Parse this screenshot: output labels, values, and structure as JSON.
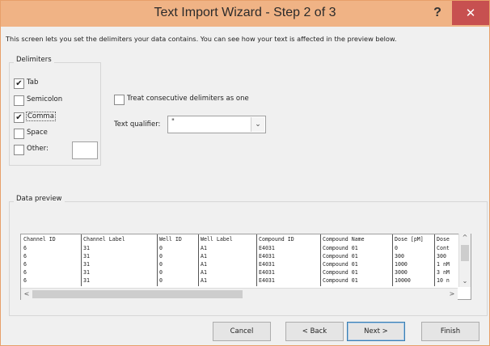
{
  "window": {
    "title": "Text Import Wizard - Step 2 of 3",
    "help_label": "?",
    "close_label": "✕"
  },
  "intro_text": "This screen lets you set the delimiters your data contains.  You can see how your text is affected in the preview below.",
  "delimiters": {
    "group_label": "Delimiters",
    "tab": {
      "label": "Tab",
      "checked": true
    },
    "semicolon": {
      "label": "Semicolon",
      "checked": false
    },
    "comma": {
      "label": "Comma",
      "checked": true
    },
    "space": {
      "label": "Space",
      "checked": false
    },
    "other": {
      "label": "Other:",
      "checked": false,
      "value": ""
    },
    "check_mark": "✔"
  },
  "consecutive": {
    "label": "Treat consecutive delimiters as one",
    "checked": false
  },
  "qualifier": {
    "label": "Text qualifier:",
    "value": "\"",
    "dropdown_icon": "chevron-down-icon",
    "arrow": "⌄"
  },
  "preview": {
    "label": "Data preview",
    "headers": [
      "Channel ID",
      "Channel Label",
      "Well ID",
      "Well Label",
      "Compound ID",
      "Compound Name",
      "Dose [pM]",
      "Dose"
    ],
    "rows": [
      [
        "6",
        "31",
        "0",
        "A1",
        "E4031",
        "Compound 01",
        "0",
        "Cont"
      ],
      [
        "6",
        "31",
        "0",
        "A1",
        "E4031",
        "Compound 01",
        "300",
        "300"
      ],
      [
        "6",
        "31",
        "0",
        "A1",
        "E4031",
        "Compound 01",
        "1000",
        "1 nM"
      ],
      [
        "6",
        "31",
        "0",
        "A1",
        "E4031",
        "Compound 01",
        "3000",
        "3 nM"
      ],
      [
        "6",
        "31",
        "0",
        "A1",
        "E4031",
        "Compound 01",
        "10000",
        "10 n"
      ]
    ],
    "scroll_up": "^",
    "scroll_down": "⌄",
    "scroll_left": "<",
    "scroll_right": ">"
  },
  "buttons": {
    "cancel": "Cancel",
    "back": "< Back",
    "next": "Next >",
    "finish": "Finish"
  }
}
